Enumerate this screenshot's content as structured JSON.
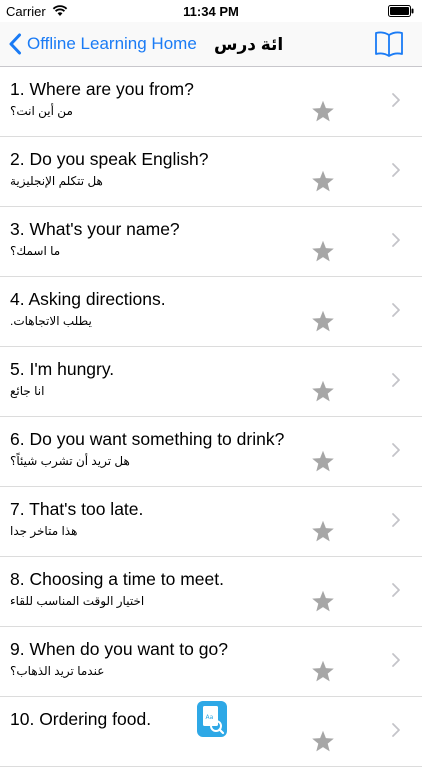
{
  "status_bar": {
    "carrier": "Carrier",
    "time": "11:34 PM",
    "icons": [
      "wifi-icon",
      "battery-icon"
    ]
  },
  "nav": {
    "back_label": "Offline Learning Home",
    "title": "ائة درس",
    "accent_color": "#1a7bf5",
    "icons": [
      "back-chevron-icon",
      "book-icon"
    ]
  },
  "lessons": [
    {
      "title": "1. Where are you from?",
      "subtitle": "من أين انت؟"
    },
    {
      "title": "2. Do you speak English?",
      "subtitle": "هل تتكلم الإنجليزية"
    },
    {
      "title": "3. What's your name?",
      "subtitle": "ما اسمك؟"
    },
    {
      "title": "4. Asking directions.",
      "subtitle": "يطلب الاتجاهات."
    },
    {
      "title": "5. I'm hungry.",
      "subtitle": "انا جائع"
    },
    {
      "title": "6. Do you want something to drink?",
      "subtitle": "هل تريد أن تشرب شيئاً؟"
    },
    {
      "title": "7. That's too late.",
      "subtitle": "هذا متاخر جدا"
    },
    {
      "title": "8. Choosing a time to meet.",
      "subtitle": "اختيار الوقت المناسب للقاء"
    },
    {
      "title": "9. When do you want to go?",
      "subtitle": "عندما تريد الذهاب؟"
    },
    {
      "title": "10. Ordering food.",
      "subtitle": ""
    }
  ],
  "row_icons": [
    "star-icon",
    "chevron-right-icon"
  ],
  "star_color": "#a6a6a6",
  "floating_icon": "dictionary-app-icon"
}
